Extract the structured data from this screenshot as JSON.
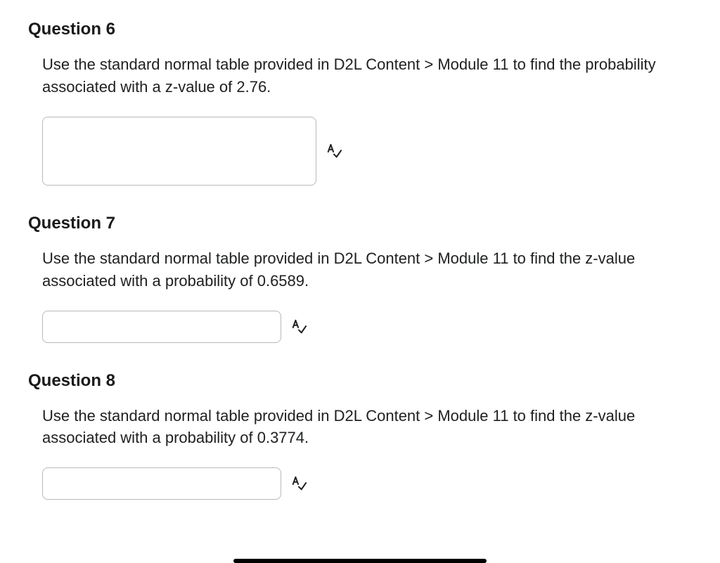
{
  "questions": [
    {
      "title": "Question 6",
      "prompt": "Use the standard normal table provided in D2L Content > Module 11 to find the probability associated with a z-value of 2.76.",
      "answer_value": ""
    },
    {
      "title": "Question 7",
      "prompt": "Use the standard normal table provided in D2L Content > Module 11 to find the z-value associated with a probability of 0.6589.",
      "answer_value": ""
    },
    {
      "title": "Question 8",
      "prompt": "Use the standard normal table provided in D2L Content > Module 11 to find the z-value associated with a probability of 0.3774.",
      "answer_value": ""
    }
  ]
}
